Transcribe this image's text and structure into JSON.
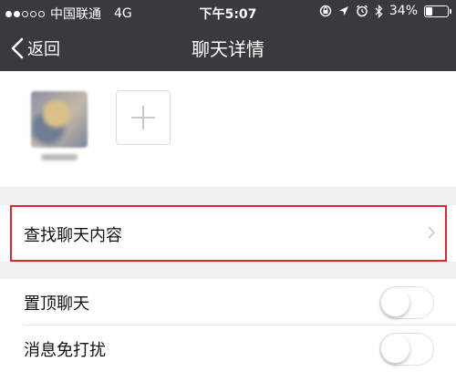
{
  "status_bar": {
    "carrier": "中国联通",
    "network": "4G",
    "time": "下午5:07",
    "battery_percent": "34%",
    "battery_level": 0.34,
    "icons": [
      "signal-dots-icon",
      "rotation-lock-icon",
      "location-arrow-icon",
      "alarm-icon",
      "bluetooth-icon",
      "battery-icon"
    ]
  },
  "nav": {
    "back_label": "返回",
    "title": "聊天详情"
  },
  "members": {
    "add_icon": "plus-icon"
  },
  "search_cell": {
    "label": "查找聊天内容",
    "highlight_color": "#e2242b"
  },
  "settings": [
    {
      "label": "置顶聊天",
      "enabled": false
    },
    {
      "label": "消息免打扰",
      "enabled": false
    }
  ],
  "colors": {
    "header_bg": "#393a3f",
    "page_bg": "#efeff4"
  }
}
